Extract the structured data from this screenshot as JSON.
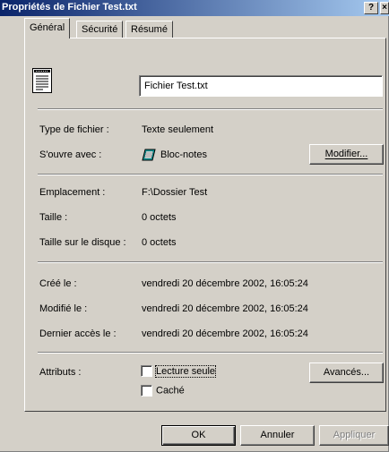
{
  "window": {
    "title": "Propriétés de Fichier Test.txt",
    "help_label": "?",
    "close_label": "×"
  },
  "tabs": [
    {
      "label": "Général",
      "active": true
    },
    {
      "label": "Sécurité",
      "active": false
    },
    {
      "label": "Résumé",
      "active": false
    }
  ],
  "file": {
    "name": "Fichier Test.txt",
    "icon": "text-file-icon"
  },
  "info": {
    "type_label": "Type de fichier :",
    "type_value": "Texte seulement",
    "opens_label": "S'ouvre avec :",
    "opens_value": "Bloc-notes",
    "opens_icon": "notepad-icon",
    "modify_button": "Modifier...",
    "location_label": "Emplacement :",
    "location_value": "F:\\Dossier Test",
    "size_label": "Taille :",
    "size_value": "0 octets",
    "disk_size_label": "Taille sur le disque :",
    "disk_size_value": "0 octets",
    "created_label": "Créé le :",
    "created_value": "vendredi 20 décembre 2002, 16:05:24",
    "modified_label": "Modifié le :",
    "modified_value": "vendredi 20 décembre 2002, 16:05:24",
    "accessed_label": "Dernier accès le :",
    "accessed_value": "vendredi 20 décembre 2002, 16:05:24"
  },
  "attributes": {
    "label": "Attributs :",
    "readonly_label": "Lecture seule",
    "readonly_checked": false,
    "hidden_label": "Caché",
    "hidden_checked": false,
    "advanced_button": "Avancés..."
  },
  "footer": {
    "ok": "OK",
    "cancel": "Annuler",
    "apply": "Appliquer"
  }
}
